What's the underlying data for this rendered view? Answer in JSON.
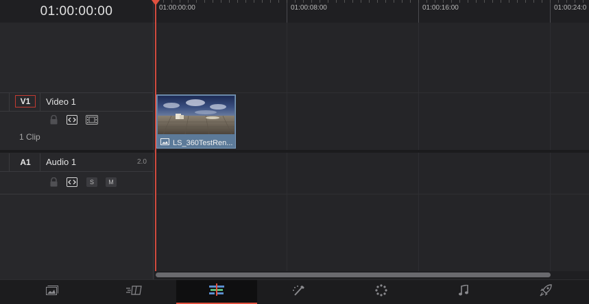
{
  "header": {
    "timecode": "01:00:00:00",
    "ruler": [
      "01:00:00:00",
      "01:00:08:00",
      "01:00:16:00",
      "01:00:24:0"
    ]
  },
  "video_track": {
    "badge": "V1",
    "name": "Video 1",
    "clip_count": "1 Clip"
  },
  "audio_track": {
    "badge": "A1",
    "name": "Audio 1",
    "channel": "2.0",
    "solo": "S",
    "mute": "M"
  },
  "clip": {
    "name": "LS_360TestRen..."
  },
  "pages": [
    "media",
    "cut",
    "edit",
    "color",
    "fairlight-fusion",
    "fairlight",
    "deliver"
  ],
  "active_page": "edit",
  "colors": {
    "playhead": "#e0513f",
    "clip": "#5c7a99",
    "video_badge_border": "#c43b32"
  }
}
